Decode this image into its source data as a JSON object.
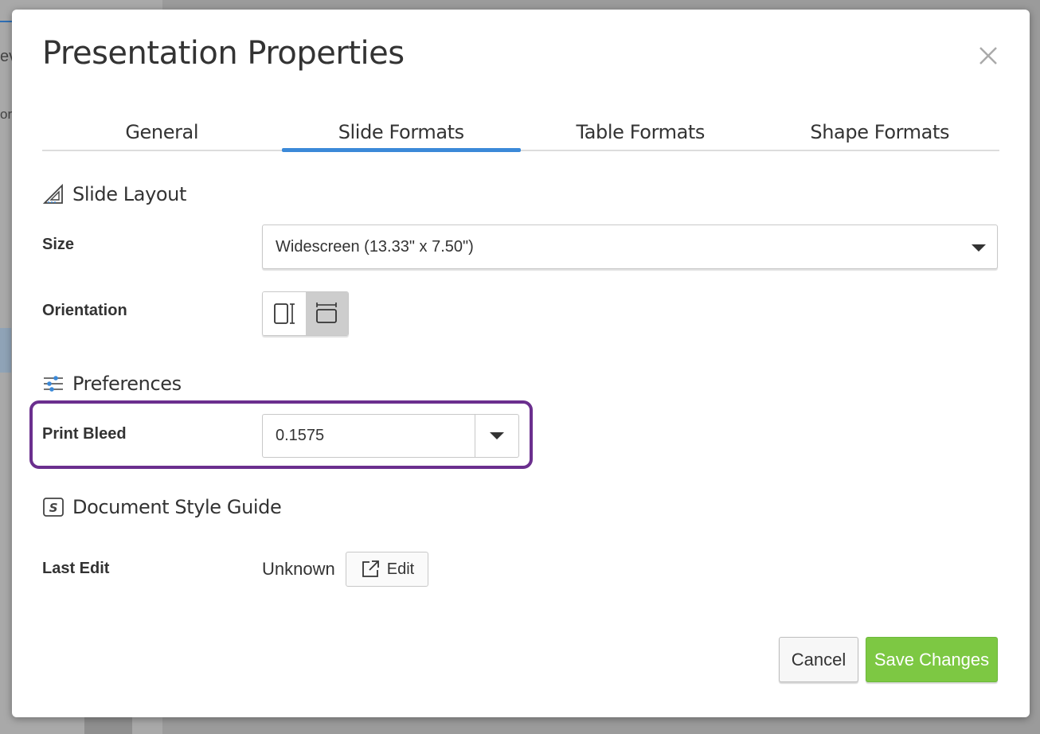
{
  "background": {
    "fragments": [
      "ev",
      "or"
    ]
  },
  "dialog": {
    "title": "Presentation Properties",
    "close_icon": "close-icon"
  },
  "tabs": [
    {
      "label": "General",
      "active": false
    },
    {
      "label": "Slide Formats",
      "active": true
    },
    {
      "label": "Table Formats",
      "active": false
    },
    {
      "label": "Shape Formats",
      "active": false
    }
  ],
  "slide_layout": {
    "heading": "Slide Layout",
    "icon": "set-square-icon",
    "size_label": "Size",
    "size_value": "Widescreen (13.33\" x 7.50\")",
    "orientation_label": "Orientation",
    "orientation_options": [
      {
        "name": "portrait",
        "selected": false
      },
      {
        "name": "landscape",
        "selected": true
      }
    ]
  },
  "preferences": {
    "heading": "Preferences",
    "icon": "sliders-icon",
    "print_bleed_label": "Print Bleed",
    "print_bleed_value": "0.1575"
  },
  "style_guide": {
    "heading": "Document Style Guide",
    "icon": "style-guide-icon",
    "last_edit_label": "Last Edit",
    "last_edit_value": "Unknown",
    "edit_label": "Edit"
  },
  "footer": {
    "cancel_label": "Cancel",
    "save_label": "Save Changes"
  },
  "colors": {
    "accent": "#3b89d8",
    "highlight": "#6b2f8e",
    "save": "#7dc843"
  }
}
